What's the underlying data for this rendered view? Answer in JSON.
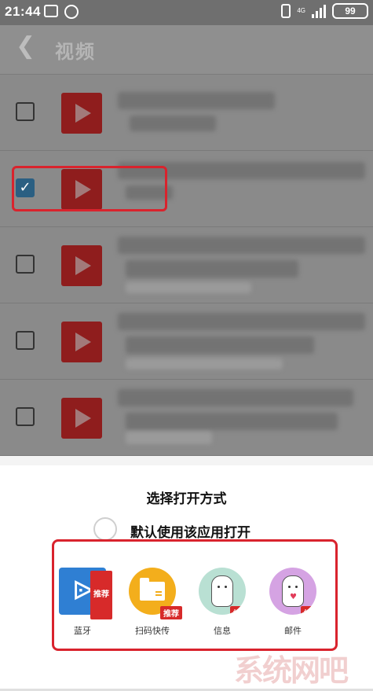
{
  "status_bar": {
    "time": "21:44",
    "battery": "99",
    "network": "4G"
  },
  "header": {
    "title": "视频"
  },
  "list": {
    "items": [
      {
        "checked": false
      },
      {
        "checked": true
      },
      {
        "checked": false
      },
      {
        "checked": false
      },
      {
        "checked": false
      }
    ]
  },
  "sheet": {
    "title": "选择打开方式",
    "default_label": "默认使用该应用打开",
    "apps": [
      {
        "label": "蓝牙",
        "badge": "推荐",
        "icon": "bluetooth-icon"
      },
      {
        "label": "扫码快传",
        "badge": "推荐",
        "icon": "folder-icon"
      },
      {
        "label": "信息",
        "badge": "推荐",
        "icon": "messages-icon"
      },
      {
        "label": "邮件",
        "badge": "推荐",
        "icon": "mail-icon"
      }
    ]
  },
  "watermark": "系统网吧",
  "colors": {
    "highlight": "#d9232d",
    "badge": "#d72a2a",
    "bluetooth": "#2f7fd3",
    "scan": "#f3ae1c"
  }
}
